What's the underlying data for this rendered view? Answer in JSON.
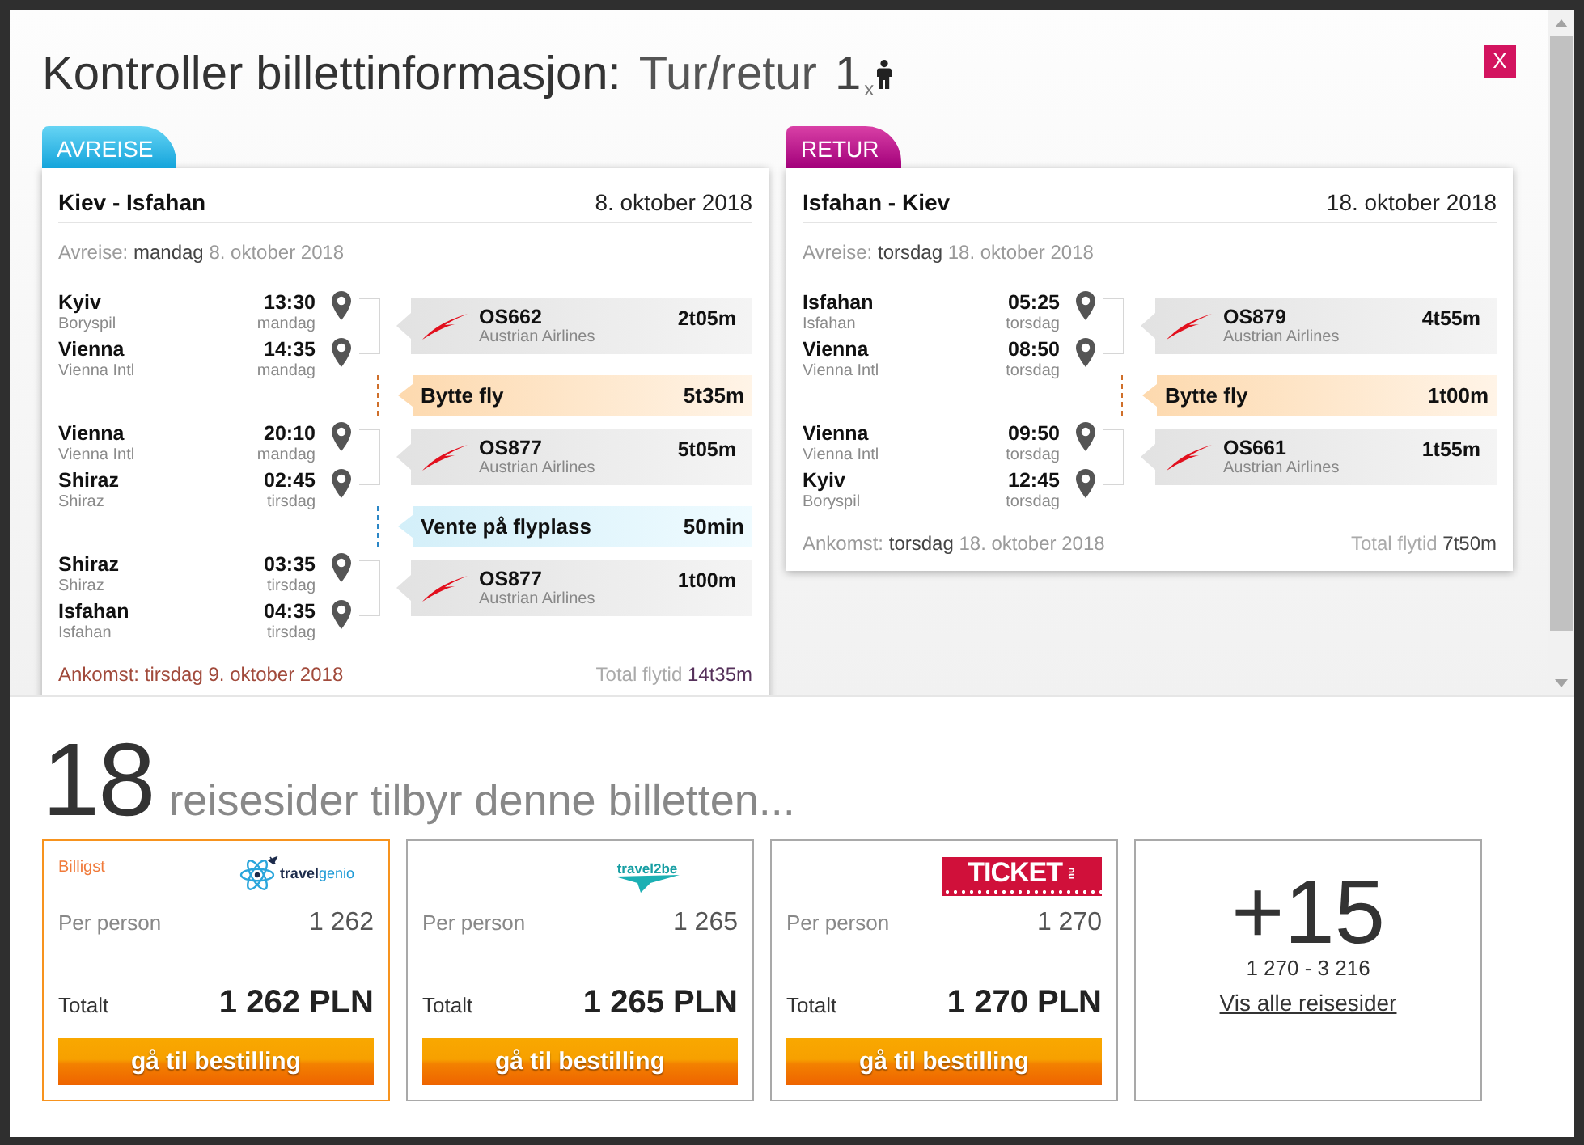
{
  "window": {
    "title": "Kontroller billettinformasjon:",
    "trip_type": "Tur/retur",
    "passengers": "1$_{x}$",
    "close": "X"
  },
  "journeys": [
    {
      "kind": "outbound",
      "tab": "AVREISE",
      "route": "Kiev - Isfahan",
      "date": "8. oktober 2018",
      "departure": {
        "label": "Avreise:",
        "weekday": "mandag",
        "date": "8. oktober 2018"
      },
      "legs": [
        {
          "kind": "flight",
          "stops": [
            {
              "city": "Kyiv",
              "airport": "Boryspil",
              "time": "13:30",
              "day": "mandag"
            },
            {
              "city": "Vienna",
              "airport": "Vienna Intl",
              "time": "14:35",
              "day": "mandag"
            }
          ],
          "flight": "OS662",
          "airline": "Austrian Airlines",
          "duration": "2t05m"
        },
        {
          "kind": "change",
          "label": "Bytte fly",
          "duration": "5t35m"
        },
        {
          "kind": "flight",
          "stops": [
            {
              "city": "Vienna",
              "airport": "Vienna Intl",
              "time": "20:10",
              "day": "mandag"
            },
            {
              "city": "Shiraz",
              "airport": "Shiraz",
              "time": "02:45",
              "day": "tirsdag"
            }
          ],
          "flight": "OS877",
          "airline": "Austrian Airlines",
          "duration": "5t05m"
        },
        {
          "kind": "wait",
          "label": "Vente på flyplass",
          "duration": "50min"
        },
        {
          "kind": "flight",
          "stops": [
            {
              "city": "Shiraz",
              "airport": "Shiraz",
              "time": "03:35",
              "day": "tirsdag"
            },
            {
              "city": "Isfahan",
              "airport": "Isfahan",
              "time": "04:35",
              "day": "tirsdag"
            }
          ],
          "flight": "OS877",
          "airline": "Austrian Airlines",
          "duration": "1t00m"
        }
      ],
      "arrival": {
        "label": "Ankomst:",
        "weekday": "tirsdag",
        "date": "9. oktober 2018",
        "highlighted": true
      },
      "total": {
        "label": "Total flytid",
        "value": "14t35m"
      }
    },
    {
      "kind": "return",
      "tab": "RETUR",
      "route": "Isfahan - Kiev",
      "date": "18. oktober 2018",
      "departure": {
        "label": "Avreise:",
        "weekday": "torsdag",
        "date": "18. oktober 2018"
      },
      "legs": [
        {
          "kind": "flight",
          "stops": [
            {
              "city": "Isfahan",
              "airport": "Isfahan",
              "time": "05:25",
              "day": "torsdag"
            },
            {
              "city": "Vienna",
              "airport": "Vienna Intl",
              "time": "08:50",
              "day": "torsdag"
            }
          ],
          "flight": "OS879",
          "airline": "Austrian Airlines",
          "duration": "4t55m"
        },
        {
          "kind": "change",
          "label": "Bytte fly",
          "duration": "1t00m"
        },
        {
          "kind": "flight",
          "stops": [
            {
              "city": "Vienna",
              "airport": "Vienna Intl",
              "time": "09:50",
              "day": "torsdag"
            },
            {
              "city": "Kyiv",
              "airport": "Boryspil",
              "time": "12:45",
              "day": "torsdag"
            }
          ],
          "flight": "OS661",
          "airline": "Austrian Airlines",
          "duration": "1t55m"
        }
      ],
      "arrival": {
        "label": "Ankomst:",
        "weekday": "torsdag",
        "date": "18. oktober 2018",
        "highlighted": false
      },
      "total": {
        "label": "Total flytid",
        "value": "7t50m"
      }
    }
  ],
  "offers_heading": {
    "count": "18",
    "text": "reisesider tilbyr denne billetten..."
  },
  "offers": [
    {
      "cheapest": true,
      "badge": "Billigst",
      "logo": {
        "kind": "atom",
        "text": "travel",
        "accent": "genio"
      },
      "per_person_label": "Per person",
      "per_person": "1 262",
      "total_label": "Totalt",
      "total": "1 262 PLN",
      "button": "gå til bestilling"
    },
    {
      "cheapest": false,
      "logo": {
        "kind": "plane",
        "text": "travel2be"
      },
      "per_person_label": "Per person",
      "per_person": "1 265",
      "total_label": "Totalt",
      "total": "1 265 PLN",
      "button": "gå til bestilling"
    },
    {
      "cheapest": false,
      "logo": {
        "kind": "banner",
        "text": "TICKET",
        "accent": "nu"
      },
      "per_person_label": "Per person",
      "per_person": "1 270",
      "total_label": "Totalt",
      "total": "1 270 PLN",
      "button": "gå til bestilling"
    }
  ],
  "more": {
    "count": "+15",
    "range": "1 270 - 3 216",
    "link": "Vis alle reisesider"
  }
}
